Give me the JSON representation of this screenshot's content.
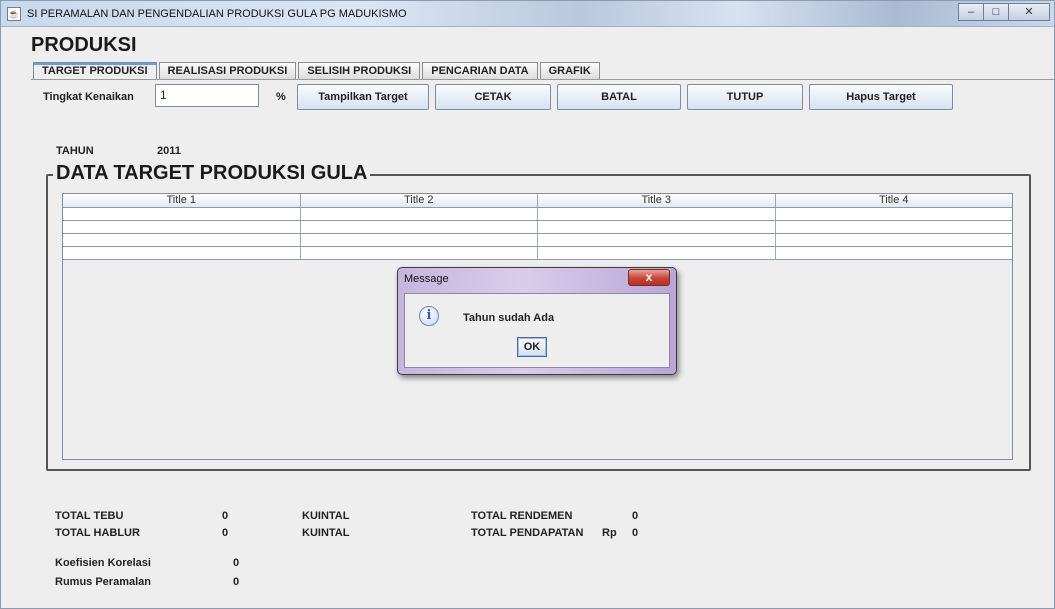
{
  "window": {
    "title": "SI PERAMALAN DAN PENGENDALIAN PRODUKSI GULA PG MADUKISMO",
    "icon": "java-cup-icon",
    "minimize": "–",
    "maximize": "□",
    "close": "✕"
  },
  "page": {
    "heading": "PRODUKSI"
  },
  "tabs": [
    {
      "label": "TARGET PRODUKSI",
      "active": true
    },
    {
      "label": "REALISASI PRODUKSI",
      "active": false
    },
    {
      "label": "SELISIH PRODUKSI",
      "active": false
    },
    {
      "label": "PENCARIAN DATA",
      "active": false
    },
    {
      "label": "GRAFIK",
      "active": false
    }
  ],
  "toolbar": {
    "tingkat_label": "Tingkat Kenaikan",
    "tingkat_value": "1",
    "percent": "%",
    "buttons": {
      "tampilkan": "Tampilkan Target",
      "cetak": "CETAK",
      "batal": "BATAL",
      "tutup": "TUTUP",
      "hapus": "Hapus Target"
    }
  },
  "tahun": {
    "label": "TAHUN",
    "value": "2011"
  },
  "group": {
    "title": "DATA TARGET PRODUKSI GULA"
  },
  "table": {
    "columns": [
      "Title 1",
      "Title 2",
      "Title 3",
      "Title 4"
    ],
    "rows": [
      [
        "",
        "",
        "",
        ""
      ],
      [
        "",
        "",
        "",
        ""
      ],
      [
        "",
        "",
        "",
        ""
      ],
      [
        "",
        "",
        "",
        ""
      ]
    ]
  },
  "dialog": {
    "title": "Message",
    "close": "x",
    "icon": "info-icon",
    "icon_glyph": "i",
    "message": "Tahun sudah Ada",
    "ok": "OK"
  },
  "summary": {
    "total_tebu_label": "TOTAL TEBU",
    "total_tebu_value": "0",
    "total_tebu_unit": "KUINTAL",
    "total_hablur_label": "TOTAL HABLUR",
    "total_hablur_value": "0",
    "total_hablur_unit": "KUINTAL",
    "total_rendemen_label": "TOTAL RENDEMEN",
    "total_rendemen_value": "0",
    "total_pendapatan_label": "TOTAL PENDAPATAN",
    "total_pendapatan_currency": "Rp",
    "total_pendapatan_value": "0",
    "koefisien_label": "Koefisien Korelasi",
    "koefisien_value": "0",
    "rumus_label": "Rumus Peramalan",
    "rumus_value": "0"
  }
}
